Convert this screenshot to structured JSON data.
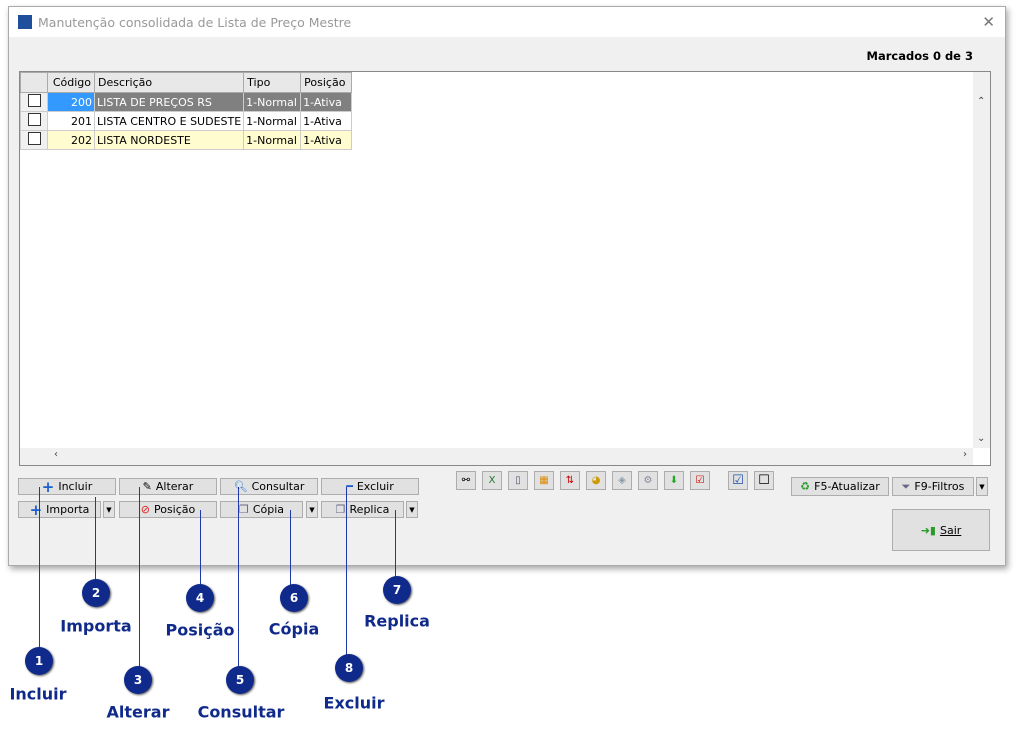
{
  "window": {
    "title": "Manutenção consolidada de Lista de Preço Mestre",
    "marked": "Marcados 0 de 3"
  },
  "grid": {
    "columns": [
      "",
      "Código",
      "Descrição",
      "Tipo",
      "Posição"
    ],
    "rows": [
      {
        "codigo": "200",
        "descricao": "LISTA DE PREÇOS RS",
        "tipo": "1-Normal",
        "posicao": "1-Ativa"
      },
      {
        "codigo": "201",
        "descricao": "LISTA CENTRO E SUDESTE",
        "tipo": "1-Normal",
        "posicao": "1-Ativa"
      },
      {
        "codigo": "202",
        "descricao": "LISTA NORDESTE",
        "tipo": "1-Normal",
        "posicao": "1-Ativa"
      }
    ]
  },
  "buttons": {
    "incluir": "Incluir",
    "alterar": "Alterar",
    "consultar": "Consultar",
    "excluir": "Excluir",
    "importa": "Importa",
    "posicao": "Posição",
    "copia": "Cópia",
    "replica": "Replica",
    "atualizar": "F5-Atualizar",
    "filtros": "F9-Filtros",
    "sair": "Sair"
  },
  "annotations": [
    {
      "n": "1",
      "label": "Incluir"
    },
    {
      "n": "2",
      "label": "Importa"
    },
    {
      "n": "3",
      "label": "Alterar"
    },
    {
      "n": "4",
      "label": "Posição"
    },
    {
      "n": "5",
      "label": "Consultar"
    },
    {
      "n": "6",
      "label": "Cópia"
    },
    {
      "n": "7",
      "label": "Replica"
    },
    {
      "n": "8",
      "label": "Excluir"
    }
  ],
  "colors": {
    "selected_code": "#3399ff",
    "selected_row": "#808080",
    "alt_row": "#fffdd0",
    "badge": "#0f2a8a"
  }
}
